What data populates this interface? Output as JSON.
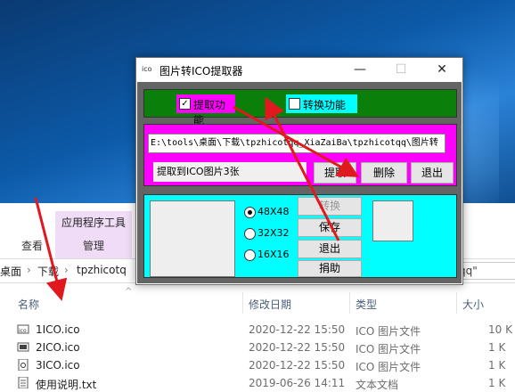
{
  "app": {
    "title": "图片转ICO提取器",
    "icon_label": "ico",
    "titlebar": {
      "minimize": "—",
      "maximize": "☐",
      "close": "✕"
    },
    "checkbox_extract": {
      "label": "提取功能",
      "checked": "✓"
    },
    "checkbox_convert": {
      "label": "转换功能",
      "checked": ""
    },
    "path_value": "E:\\tools\\桌面\\下载\\tpzhicotqq_XiaZaiBa\\tpzhicotqq\\图片转",
    "status_text": "提取到ICO图片3张",
    "buttons": {
      "extract": "提取",
      "delete": "删除",
      "exit": "退出"
    },
    "radio_options": [
      "48X48",
      "32X32",
      "16X16"
    ],
    "side_buttons": {
      "convert": "转换",
      "save": "保存",
      "exit": "退出",
      "donate": "捐助"
    },
    "colors": {
      "green": "#0a7f0a",
      "magenta": "#ff00ff",
      "cyan": "#00ffff"
    }
  },
  "explorer": {
    "ribbon_context": "应用程序工具",
    "tabs": [
      "查看",
      "管理"
    ],
    "breadcrumb": [
      "桌面",
      "下载",
      "tpzhicotq"
    ],
    "search_text": "qq\"",
    "columns": [
      "名称",
      "修改日期",
      "类型",
      "大小"
    ],
    "files": [
      {
        "name": "1ICO.ico",
        "date": "2020-12-22 15:50",
        "type": "ICO 图片文件",
        "size": "10 K"
      },
      {
        "name": "2ICO.ico",
        "date": "2020-12-22 15:50",
        "type": "ICO 图片文件",
        "size": "1 K"
      },
      {
        "name": "3ICO.ico",
        "date": "2020-12-22 15:50",
        "type": "ICO 图片文件",
        "size": "1 K"
      },
      {
        "name": "使用说明.txt",
        "date": "2019-06-26 14:11",
        "type": "文本文档",
        "size": "1 K"
      }
    ]
  }
}
